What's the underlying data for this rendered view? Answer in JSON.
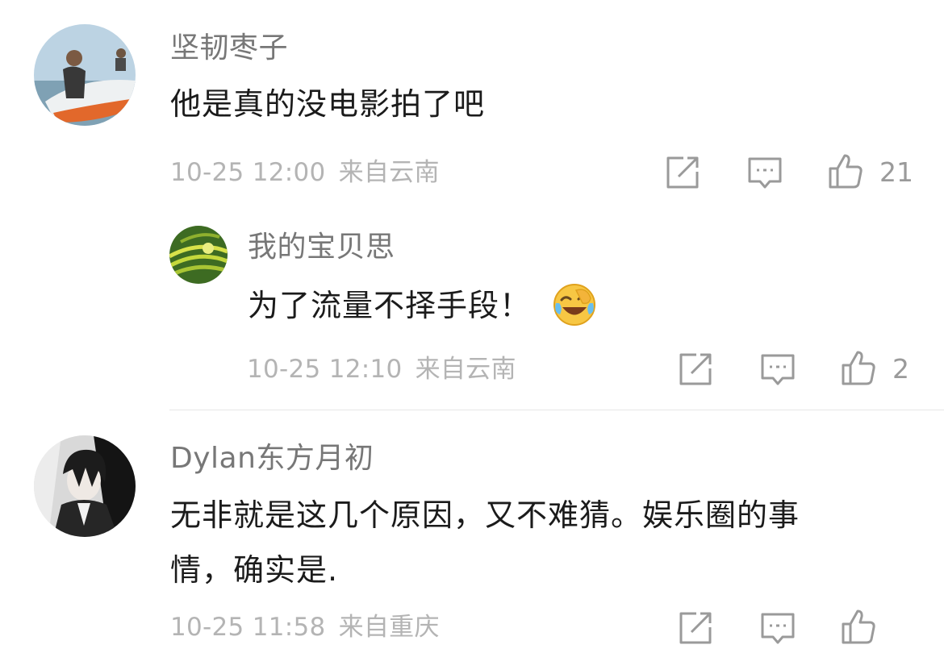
{
  "comments": [
    {
      "username": "坚韧枣子",
      "text": "他是真的没电影拍了吧",
      "time": "10-25 12:00",
      "location": "来自云南",
      "likes": "21",
      "replies": [
        {
          "username": "我的宝贝思",
          "text": "为了流量不择手段！",
          "emoji": "laughing-crying-emoji",
          "time": "10-25 12:10",
          "location": "来自云南",
          "likes": "2"
        }
      ]
    },
    {
      "username": "Dylan东方月初",
      "text_line1": "无非就是这几个原因，又不难猜。娱乐圈的事",
      "text_line2": "情，确实是.",
      "time": "10-25 11:58",
      "location": "来自重庆"
    }
  ],
  "icons": {
    "share": "share-icon",
    "comment": "comment-icon",
    "like": "thumbs-up-icon"
  }
}
